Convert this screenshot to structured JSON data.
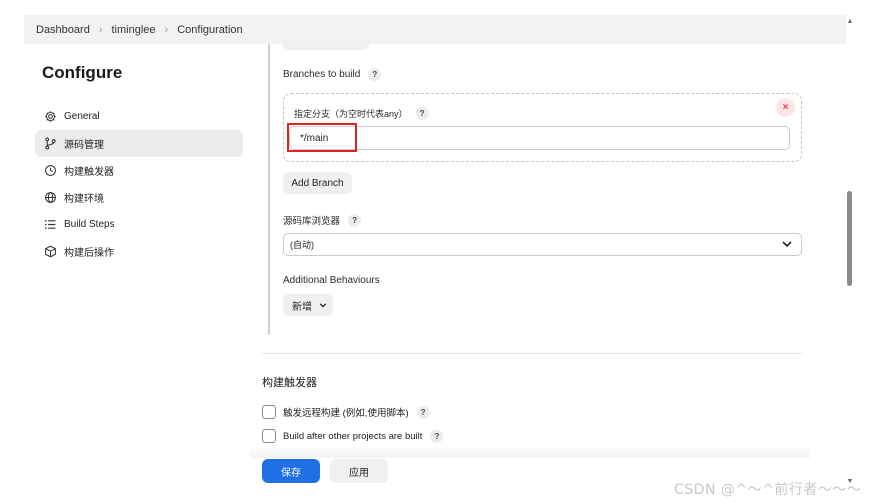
{
  "breadcrumb": {
    "items": [
      "Dashboard",
      "timinglee",
      "Configuration"
    ],
    "separator": "›"
  },
  "page_title": "Configure",
  "sidebar": {
    "items": [
      {
        "label": "General",
        "icon": "gear-icon",
        "active": false
      },
      {
        "label": "源码管理",
        "icon": "branch-icon",
        "active": true
      },
      {
        "label": "构建触发器",
        "icon": "clock-icon",
        "active": false
      },
      {
        "label": "构建环境",
        "icon": "globe-icon",
        "active": false
      },
      {
        "label": "Build Steps",
        "icon": "list-icon",
        "active": false
      },
      {
        "label": "构建后操作",
        "icon": "package-icon",
        "active": false
      }
    ]
  },
  "scm": {
    "branches_label": "Branches to build",
    "branch_specifier_label": "指定分支（为空时代表any）",
    "branch_value": "*/main",
    "add_branch_label": "Add Branch",
    "repo_browser_label": "源码库浏览器",
    "repo_browser_value": "(自动)",
    "additional_behaviours_label": "Additional Behaviours",
    "add_behaviour_label": "新增"
  },
  "triggers": {
    "heading": "构建触发器",
    "options": [
      {
        "label": "触发远程构建 (例如,使用脚本)",
        "checked": false
      },
      {
        "label": "Build after other projects are built",
        "checked": false
      }
    ]
  },
  "footer": {
    "save_label": "保存",
    "apply_label": "应用"
  },
  "help_glyph": "?",
  "close_glyph": "×",
  "watermark": "CSDN @^～^前行者～～～",
  "colors": {
    "primary": "#1f6fe5",
    "highlight": "#e02424",
    "close": "#e0394a"
  }
}
